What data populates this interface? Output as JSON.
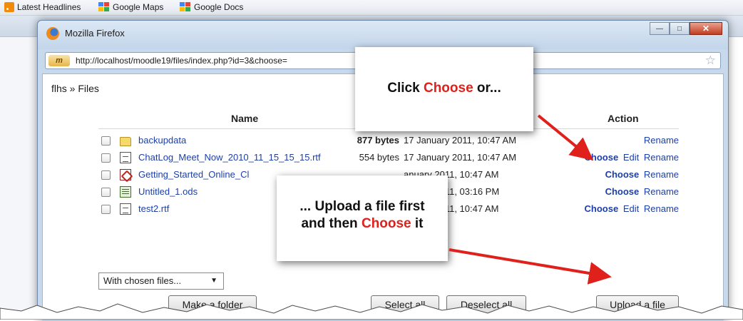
{
  "background_browser": {
    "bookmarks": [
      {
        "label": "Latest Headlines",
        "icon": "rss-icon"
      },
      {
        "label": "Google Maps",
        "icon": "google-icon"
      },
      {
        "label": "Google Docs",
        "icon": "google-icon"
      }
    ]
  },
  "window": {
    "title": "Mozilla Firefox",
    "controls": [
      "minimize",
      "maximize",
      "close"
    ],
    "url_bar": {
      "site_badge": "m",
      "url": "http://localhost/moodle19/files/index.php?id=3&choose="
    }
  },
  "page": {
    "breadcrumb": "flhs » Files",
    "table": {
      "headers": {
        "name": "Name",
        "action": "Action"
      },
      "rows": [
        {
          "icon": "folder-icon",
          "name": "backupdata",
          "size": "877 bytes",
          "date": "17 January 2011, 10:47 AM",
          "actions": [
            "Rename"
          ]
        },
        {
          "icon": "document-icon",
          "name": "ChatLog_Meet_Now_2010_11_15_15_15.rtf",
          "size": "554 bytes",
          "date": "17 January 2011, 10:47 AM",
          "actions": [
            "Choose",
            "Edit",
            "Rename"
          ]
        },
        {
          "icon": "pdf-icon",
          "name": "Getting_Started_Online_Cl",
          "size": "",
          "date": "anuary 2011, 10:47 AM",
          "actions": [
            "Choose",
            "Rename"
          ]
        },
        {
          "icon": "spreadsheet-icon",
          "name": "Untitled_1.ods",
          "size": "",
          "date": "anuary 2011, 03:16 PM",
          "actions": [
            "Choose",
            "Rename"
          ]
        },
        {
          "icon": "document-icon",
          "name": "test2.rtf",
          "size": "",
          "date": "anuary 2011, 10:47 AM",
          "actions": [
            "Choose",
            "Edit",
            "Rename"
          ]
        }
      ]
    },
    "with_chosen_select": "With chosen files...",
    "buttons": {
      "make_folder": "Make a folder",
      "select_all": "Select all",
      "deselect_all": "Deselect all",
      "upload": "Upload a file"
    }
  },
  "annotations": {
    "callout1": {
      "part1": "Click ",
      "highlight": "Choose",
      "part2": " or..."
    },
    "callout2": {
      "line1": "... Upload a file first",
      "line2_part1": "and then ",
      "highlight": "Choose",
      "line2_part2": " it"
    }
  },
  "colors": {
    "link": "#1c3fa8",
    "annotation_red": "#e0201b"
  }
}
